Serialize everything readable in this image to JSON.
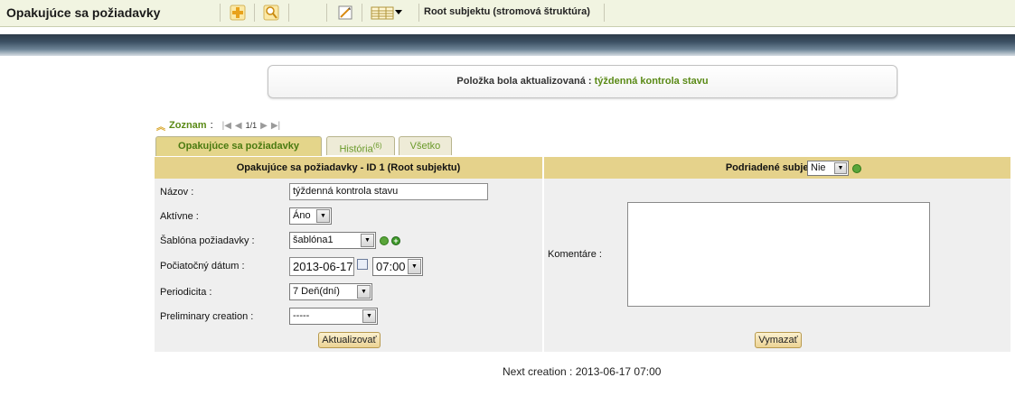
{
  "app": {
    "title": "Opakujúce sa požiadavky",
    "root_label": "Root subjektu (stromová štruktúra)"
  },
  "toolbar": {
    "icons": [
      "add-icon",
      "search-icon",
      "edit-icon",
      "table-view-icon"
    ]
  },
  "notice": {
    "prefix": "Položka bola aktualizovaná : ",
    "item": "týždenná kontrola stavu"
  },
  "pager": {
    "label": "Zoznam",
    "colon": ":",
    "count": "1/1"
  },
  "tabs": [
    {
      "label": "Opakujúce sa požiadavky",
      "badge": ""
    },
    {
      "label": "História",
      "badge": "(6)"
    },
    {
      "label": "Všetko",
      "badge": ""
    }
  ],
  "form": {
    "header_left": "Opakujúce sa požiadavky - ID 1 (Root subjektu)",
    "header_right_label": "Podriadené subjekty :",
    "header_right_value": "Nie",
    "fields": {
      "name_label": "Názov :",
      "name_value": "týždenná kontrola stavu",
      "active_label": "Aktívne :",
      "active_value": "Áno",
      "template_label": "Šablóna požiadavky :",
      "template_value": "šablóna1",
      "start_label": "Počiatočný dátum :",
      "start_date": "2013-06-17",
      "start_time": "07:00",
      "period_label": "Periodicita :",
      "period_value": "7 Deň(dní)",
      "prelim_label": "Preliminary creation :",
      "prelim_value": "-----",
      "comment_label": "Komentáre :"
    },
    "update_button": "Aktualizovať",
    "delete_button": "Vymazať"
  },
  "footer": {
    "next_creation": "Next creation : 2013-06-17 07:00"
  },
  "colors": {
    "header_bg": "#f1f4e1",
    "accent_green": "#5a8a16",
    "panel_header": "#e5d28b"
  }
}
